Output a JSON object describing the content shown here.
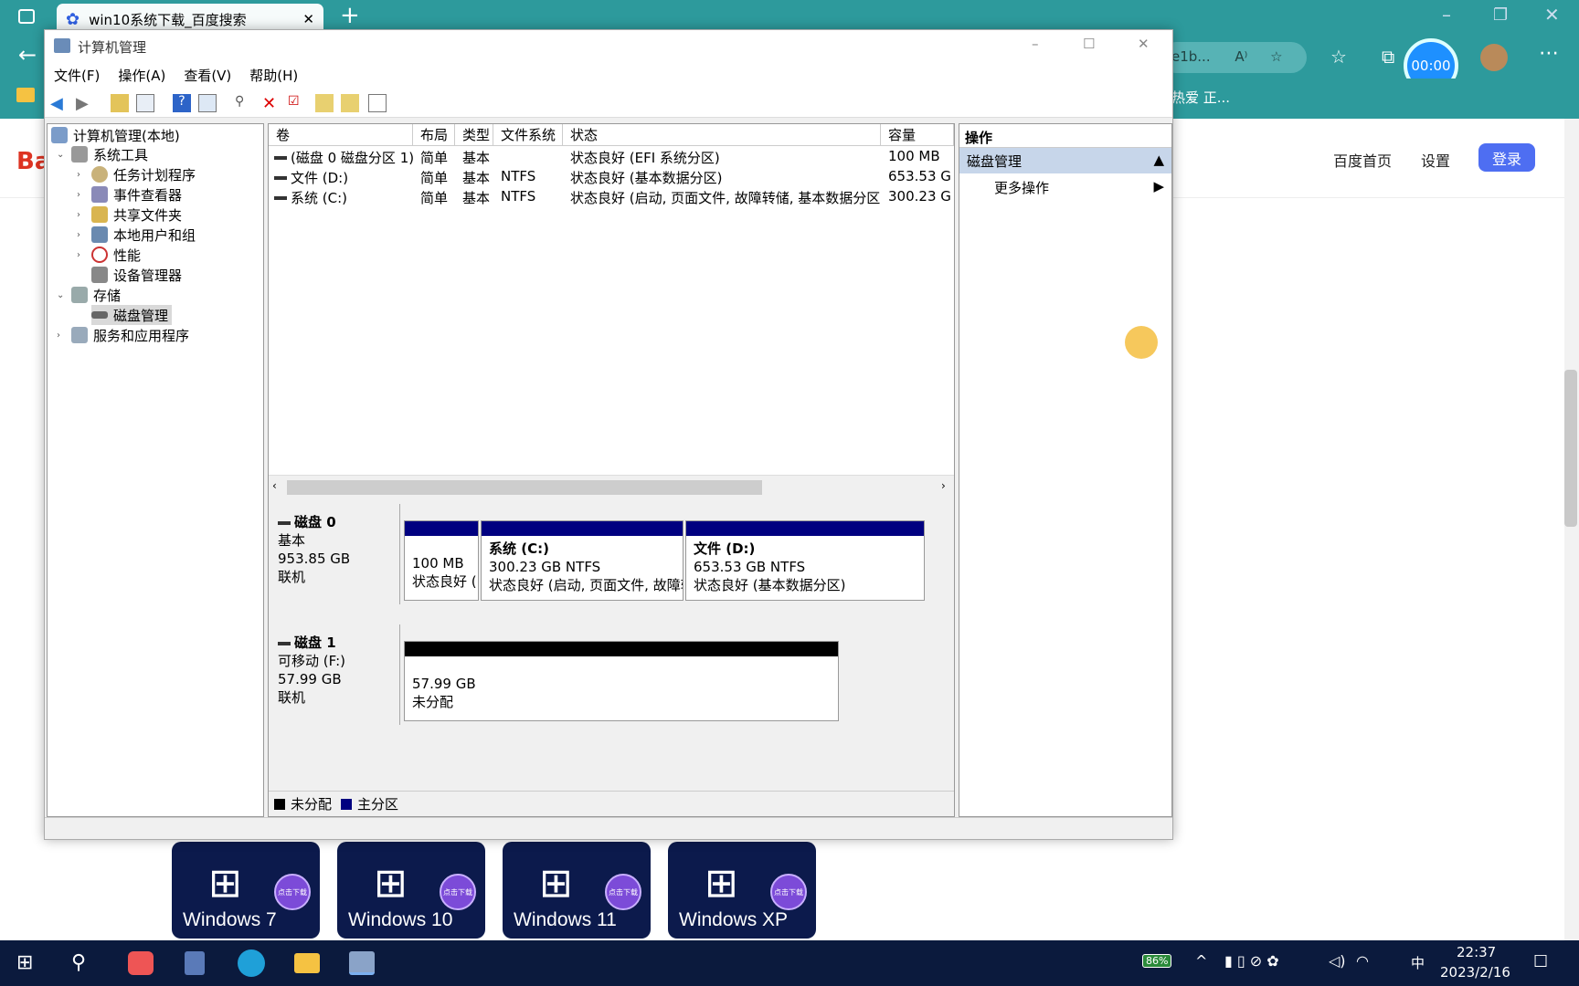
{
  "browser": {
    "tab_title": "win10系统下载_百度搜索",
    "address_fragment": "e1b...",
    "fav_text": "热爱 正...",
    "timer": "00:00",
    "links": [
      "百度首页",
      "设置"
    ],
    "login": "登录",
    "logo_fragment": "Ba"
  },
  "mmc": {
    "title": "计算机管理",
    "menu": [
      "文件(F)",
      "操作(A)",
      "查看(V)",
      "帮助(H)"
    ],
    "tree": {
      "root": "计算机管理(本地)",
      "system_tools": "系统工具",
      "task_scheduler": "任务计划程序",
      "event_viewer": "事件查看器",
      "shared_folders": "共享文件夹",
      "local_users": "本地用户和组",
      "performance": "性能",
      "device_manager": "设备管理器",
      "storage": "存储",
      "disk_management": "磁盘管理",
      "services": "服务和应用程序"
    },
    "columns": [
      "卷",
      "布局",
      "类型",
      "文件系统",
      "状态",
      "容量"
    ],
    "volumes": [
      {
        "name": "(磁盘 0 磁盘分区 1)",
        "layout": "简单",
        "type": "基本",
        "fs": "",
        "status": "状态良好 (EFI 系统分区)",
        "capacity": "100 MB"
      },
      {
        "name": "文件 (D:)",
        "layout": "简单",
        "type": "基本",
        "fs": "NTFS",
        "status": "状态良好 (基本数据分区)",
        "capacity": "653.53 G"
      },
      {
        "name": "系统 (C:)",
        "layout": "简单",
        "type": "基本",
        "fs": "NTFS",
        "status": "状态良好 (启动, 页面文件, 故障转储, 基本数据分区)",
        "capacity": "300.23 G"
      }
    ],
    "disk0": {
      "name": "磁盘 0",
      "kind": "基本",
      "size": "953.85 GB",
      "state": "联机",
      "p1_size": "100 MB",
      "p1_status": "状态良好 (",
      "c_name": "系统 (C:)",
      "c_size": "300.23 GB NTFS",
      "c_status": "状态良好 (启动, 页面文件, 故障转储",
      "d_name": "文件 (D:)",
      "d_size": "653.53 GB NTFS",
      "d_status": "状态良好 (基本数据分区)"
    },
    "disk1": {
      "name": "磁盘 1",
      "kind": "可移动 (F:)",
      "size": "57.99 GB",
      "state": "联机",
      "u_size": "57.99 GB",
      "u_status": "未分配"
    },
    "legend": {
      "unallocated": "未分配",
      "primary": "主分区"
    },
    "actions": {
      "header": "操作",
      "section": "磁盘管理",
      "more": "更多操作"
    }
  },
  "tiles": [
    "Windows 7",
    "Windows 10",
    "Windows 11",
    "Windows XP"
  ],
  "tile_badge": "点击下载",
  "taskbar": {
    "battery": "86%",
    "ime": "中",
    "time": "22:37",
    "date": "2023/2/16"
  },
  "colors": {
    "accent": "#2d9a9c",
    "primary_partition": "#000080",
    "unallocated": "#000000",
    "baidu_blue": "#4e6ef2"
  }
}
